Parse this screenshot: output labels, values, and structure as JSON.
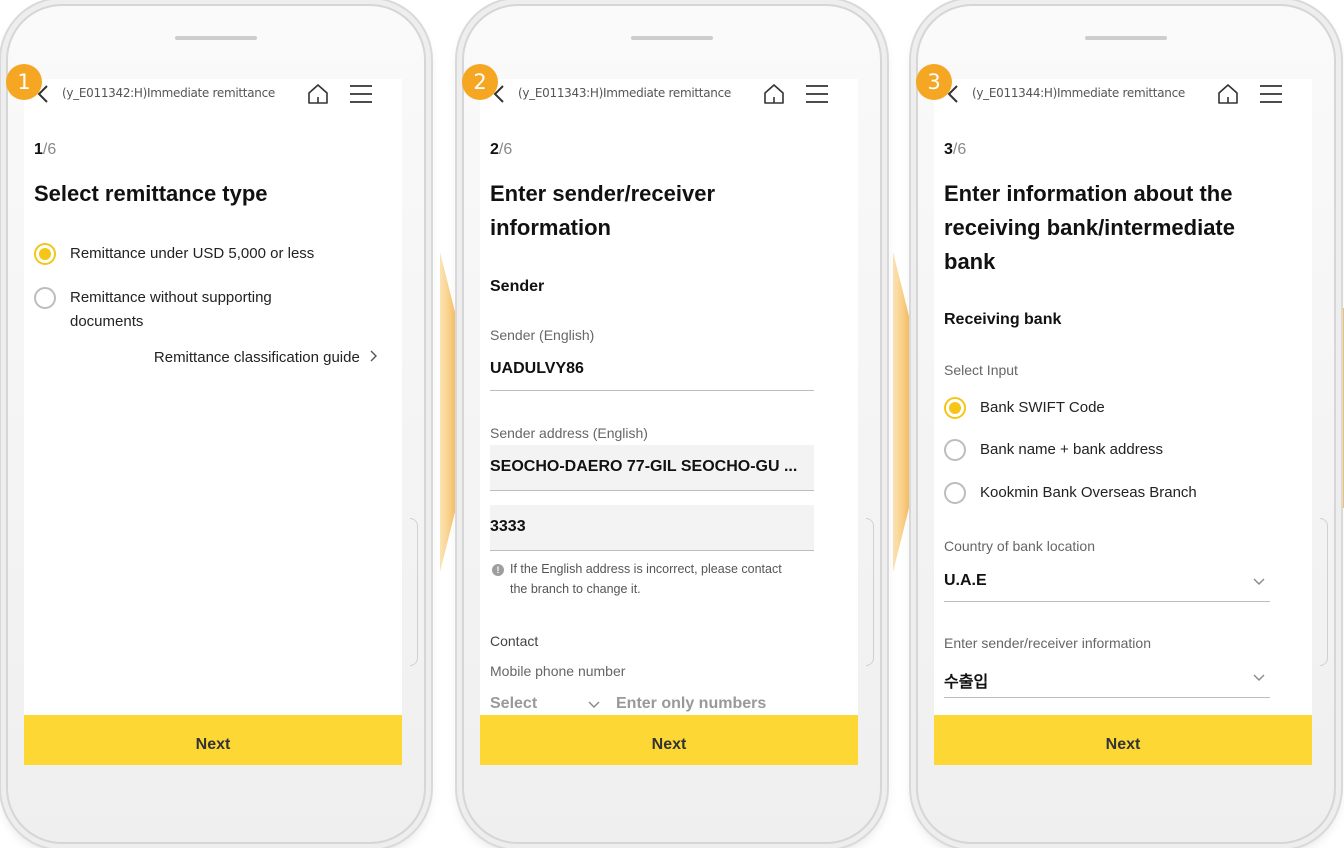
{
  "screens": [
    {
      "badge": "1",
      "title": "(y_E011342:H)Immediate remittance",
      "step_current": "1",
      "step_total": "/6",
      "heading": "Select remittance type",
      "options": [
        "Remittance under USD 5,000 or less",
        "Remittance without supporting documents"
      ],
      "selected_option": "Remittance under USD 5,000 or less",
      "guide_link": "Remittance classification guide",
      "next_label": "Next"
    },
    {
      "badge": "2",
      "title": "(y_E011343:H)Immediate remittance",
      "step_current": "2",
      "step_total": "/6",
      "heading": "Enter sender/receiver information",
      "section": "Sender",
      "sender_label": "Sender (English)",
      "sender_value": "UADULVY86",
      "address_label": "Sender address (English)",
      "address_line1": "SEOCHO-DAERO 77-GIL SEOCHO-GU ...",
      "address_line2": "3333",
      "notice": "If the English address is incorrect, please contact the branch to change it.",
      "contact_label": "Contact",
      "mobile_label": "Mobile phone number",
      "select_placeholder": "Select",
      "number_placeholder": "Enter only numbers",
      "next_label": "Next"
    },
    {
      "badge": "3",
      "title": "(y_E011344:H)Immediate remittance",
      "step_current": "3",
      "step_total": "/6",
      "heading": "Enter information about the receiving bank/intermediate bank",
      "section": "Receiving bank",
      "select_input_label": "Select Input",
      "options": [
        "Bank SWIFT Code",
        "Bank name + bank address",
        "Kookmin Bank Overseas Branch"
      ],
      "selected_option": "Bank SWIFT Code",
      "country_label": "Country of bank location",
      "country_value": "U.A.E",
      "purpose_label": "Enter sender/receiver information",
      "purpose_value": "수출입",
      "next_label": "Next"
    }
  ],
  "colors": {
    "accent": "#fdd835",
    "badge": "#f5a623",
    "radio_on": "#f5c518"
  },
  "icons": [
    "back-chevron-icon",
    "home-icon",
    "menu-icon",
    "chevron-right-icon",
    "chevron-down-icon",
    "info-icon"
  ]
}
